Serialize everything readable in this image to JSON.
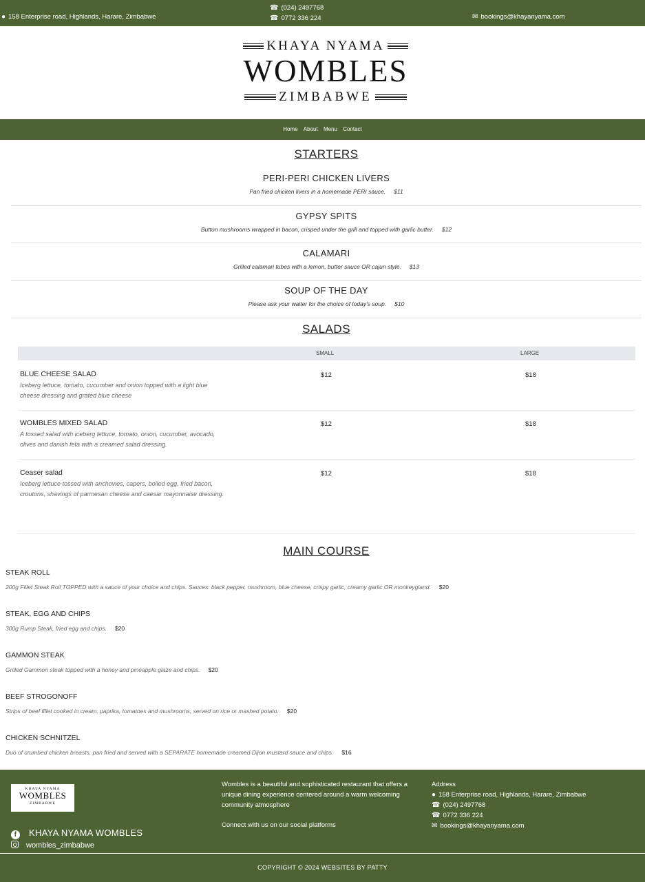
{
  "topbar": {
    "address": "158 Enterprise road, Highlands, Harare, Zimbabwe",
    "phone1": "(024) 2497768",
    "phone2": "0772 336 224",
    "email": "bookings@khayanyama.com"
  },
  "logo": {
    "line1": "KHAYA NYAMA",
    "line2": "WOMBLES",
    "line3": "ZIMBABWE"
  },
  "nav": [
    "Home",
    "About",
    "Menu",
    "Contact"
  ],
  "starters": {
    "title": "STARTERS",
    "items": [
      {
        "name": "PERI-PERI CHICKEN LIVERS",
        "desc": "Pan fried chicken livers in a homemade PERI sauce.",
        "price": "$11"
      },
      {
        "name": "GYPSY SPITS",
        "desc": "Button mushrooms wrapped in bacon, crisped under the grill and topped with garlic butter.",
        "price": "$12"
      },
      {
        "name": "CALAMARI",
        "desc": "Grilled calamari tubes with a lemon, butter sauce OR cajun style.",
        "price": "$13"
      },
      {
        "name": "SOUP OF THE DAY",
        "desc": "Please ask your waiter for the choice of today's soup.",
        "price": "$10"
      }
    ]
  },
  "salads": {
    "title": "SALADS",
    "col_small": "SMALL",
    "col_large": "LARGE",
    "items": [
      {
        "name": "BLUE CHEESE SALAD",
        "desc": "Iceberg lettuce, tomato, cucumber and onion topped with a light blue cheese dressing and grated blue cheese",
        "small": "$12",
        "large": "$18"
      },
      {
        "name": "WOMBLES MIXED SALAD",
        "desc": "A tossed salad with iceberg lettuce, tomato, onion, cucumber, avocado, olives and danish feta with a creamed salad dressing.",
        "small": "$12",
        "large": "$18"
      },
      {
        "name": "Ceaser salad",
        "desc": "Iceberg lettuce tossed with anchovies, capers, boiled egg, fried bacon, croutons, shavings of parmesan cheese and caesar mayonnaise dressing.",
        "small": "$12",
        "large": "$18"
      }
    ]
  },
  "main_course": {
    "title": "MAIN COURSE",
    "items": [
      {
        "name": "STEAK ROLL",
        "desc": "200g Fillet Steak Roll TOPPED with a sauce of your choice and chips. Sauces: black pepper, mushroom, blue cheese, crispy garlic, creamy garlic OR monkeygland.",
        "price": "$20"
      },
      {
        "name": "STEAK, EGG AND CHIPS",
        "desc": "300g Rump Steak, fried egg and chips.",
        "price": "$20"
      },
      {
        "name": "GAMMON STEAK",
        "desc": "Grilled Gammon steak topped with a honey and pineapple glaze and chips.",
        "price": "$20"
      },
      {
        "name": "BEEF STROGONOFF",
        "desc": "Strips of beef fillet cooked in cream, paprika, tomatoes and mushrooms, served on rice or mashed potato.",
        "price": "$20"
      },
      {
        "name": "CHICKEN SCHNITZEL",
        "desc": "Duo of crumbed chicken breasts, pan fried and served with a SEPARATE homemade creamed Dijon mustard sauce and chips.",
        "price": "$16"
      }
    ]
  },
  "footer": {
    "facebook": "KHAYA NYAMA WOMBLES",
    "instagram": "wombles_zimbabwe",
    "about": "Wombles is a beautiful and sophisticated restaurant that offers a unique dining experience centered around a warm welcoming community atmosphere",
    "connect": "Connect with us on our social platforms",
    "address_heading": "Address",
    "address": "158 Enterprise road, Highlands, Harare, Zimbabwe",
    "phone1": "(024) 2497768",
    "phone2": "0772 336 224",
    "email": "bookings@khayanyama.com",
    "copyright": "COPYRIGHT © 2024 WEBSITES BY PATTY"
  },
  "colors": {
    "brand_green": "#4e6334",
    "table_header": "#e7e8eb"
  },
  "icons": [
    "map-pin-icon",
    "phone-icon",
    "envelope-icon",
    "facebook-icon",
    "instagram-icon"
  ]
}
